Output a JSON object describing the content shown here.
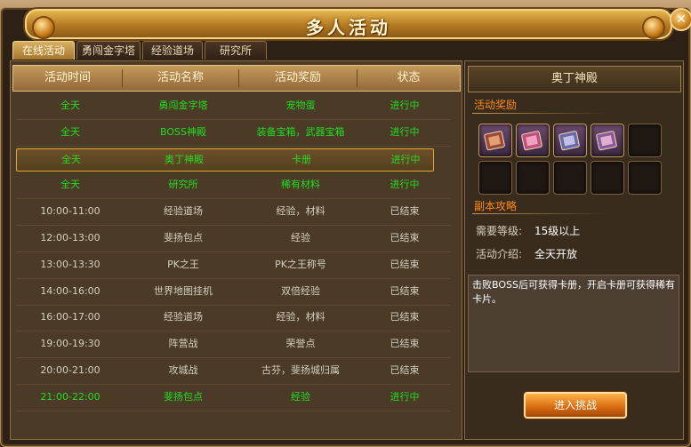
{
  "window": {
    "title": "多人活动"
  },
  "tabs": [
    "在线活动",
    "勇闯金字塔",
    "经验道场",
    "研究所"
  ],
  "table": {
    "headers": [
      "活动时间",
      "活动名称",
      "活动奖励",
      "状态"
    ],
    "rows": [
      {
        "time": "全天",
        "name": "勇闯金字塔",
        "reward": "宠物蛋",
        "status": "进行中",
        "active": true
      },
      {
        "time": "全天",
        "name": "BOSS神殿",
        "reward": "装备宝箱，武器宝箱",
        "status": "进行中",
        "active": true
      },
      {
        "time": "全天",
        "name": "奥丁神殿",
        "reward": "卡册",
        "status": "进行中",
        "active": true,
        "selected": true
      },
      {
        "time": "全天",
        "name": "研究所",
        "reward": "稀有材料",
        "status": "进行中",
        "active": true
      },
      {
        "time": "10:00-11:00",
        "name": "经验道场",
        "reward": "经验，材料",
        "status": "已结束",
        "active": false
      },
      {
        "time": "12:00-13:00",
        "name": "斐扬包点",
        "reward": "经验",
        "status": "已结束",
        "active": false
      },
      {
        "time": "13:00-13:30",
        "name": "PK之王",
        "reward": "PK之王称号",
        "status": "已结束",
        "active": false
      },
      {
        "time": "14:00-16:00",
        "name": "世界地图挂机",
        "reward": "双倍经验",
        "status": "已结束",
        "active": false
      },
      {
        "time": "16:00-17:00",
        "name": "经验道场",
        "reward": "经验，材料",
        "status": "已结束",
        "active": false
      },
      {
        "time": "19:00-19:30",
        "name": "阵营战",
        "reward": "荣誉点",
        "status": "已结束",
        "active": false
      },
      {
        "time": "20:00-21:00",
        "name": "攻城战",
        "reward": "古芬，斐扬城归属",
        "status": "已结束",
        "active": false
      },
      {
        "time": "21:00-22:00",
        "name": "斐扬包点",
        "reward": "经验",
        "status": "进行中",
        "active": true
      }
    ]
  },
  "detail": {
    "title": "奥丁神殿",
    "rewards_label": "活动奖励",
    "guide_label": "副本攻略",
    "level_label": "需要等级:",
    "level_value": "15级以上",
    "intro_label": "活动介绍:",
    "intro_value": "全天开放",
    "description": "击败BOSS后可获得卡册，开启卡册可获得稀有卡片。",
    "button": "进入挑战",
    "reward_items": [
      "card-album-icon",
      "card-album-icon",
      "card-album-icon",
      "card-album-icon"
    ],
    "empty_slots": 6
  },
  "colors": {
    "active_text": "#22dd22",
    "ended_text": "#d6d0c0",
    "accent": "#ff8a1a",
    "selected_border": "#e3a830"
  }
}
